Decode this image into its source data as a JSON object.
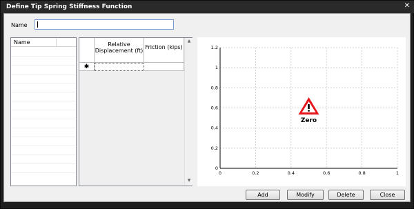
{
  "window": {
    "title": "Define Tip Spring Stiffness Function",
    "close_glyph": "✕"
  },
  "name_field": {
    "label": "Name",
    "value": ""
  },
  "name_list": {
    "header": "Name"
  },
  "grid": {
    "columns": [
      "Relative Displacement (ft)",
      "Friction (kips)"
    ],
    "new_row_marker": "✱",
    "rows": []
  },
  "plot": {
    "x_ticks": [
      "0",
      "0.2",
      "0.4",
      "0.6",
      "0.8",
      "1"
    ],
    "y_ticks": [
      "0",
      "0.2",
      "0.4",
      "0.6",
      "0.8",
      "1",
      "1.2"
    ],
    "warning_text": "Zero",
    "warning_color": "#e8141c"
  },
  "chart_data": {
    "type": "line",
    "x": [],
    "series": [],
    "title": "",
    "xlabel": "",
    "ylabel": "",
    "xlim": [
      0,
      1
    ],
    "ylim": [
      0,
      1.2
    ],
    "grid": true
  },
  "buttons": {
    "add": "Add",
    "modify": "Modify",
    "delete": "Delete",
    "close": "Close"
  }
}
